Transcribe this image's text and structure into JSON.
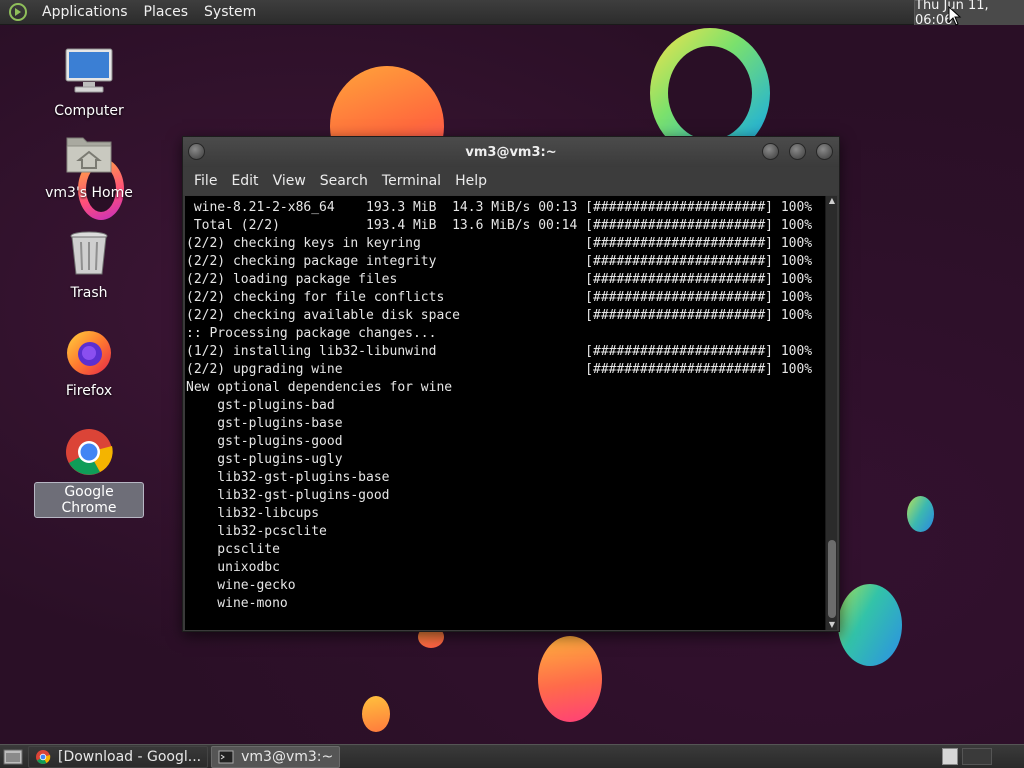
{
  "top_panel": {
    "menus": [
      "Applications",
      "Places",
      "System"
    ],
    "clock": "Thu Jun 11, 06:06"
  },
  "desktop_icons": [
    {
      "label": "Computer",
      "icon": "computer-icon"
    },
    {
      "label": "vm3's Home",
      "icon": "home-folder-icon"
    },
    {
      "label": "Trash",
      "icon": "trash-icon"
    },
    {
      "label": "Firefox",
      "icon": "firefox-icon"
    },
    {
      "label": "Google Chrome",
      "icon": "chrome-icon",
      "selected": true
    }
  ],
  "terminal": {
    "title": "vm3@vm3:~",
    "menu": [
      "File",
      "Edit",
      "View",
      "Search",
      "Terminal",
      "Help"
    ],
    "lines": [
      " wine-8.21-2-x86_64    193.3 MiB  14.3 MiB/s 00:13 [######################] 100%",
      " Total (2/2)           193.4 MiB  13.6 MiB/s 00:14 [######################] 100%",
      "(2/2) checking keys in keyring                     [######################] 100%",
      "(2/2) checking package integrity                   [######################] 100%",
      "(2/2) loading package files                        [######################] 100%",
      "(2/2) checking for file conflicts                  [######################] 100%",
      "(2/2) checking available disk space                [######################] 100%",
      ":: Processing package changes...",
      "(1/2) installing lib32-libunwind                   [######################] 100%",
      "(2/2) upgrading wine                               [######################] 100%",
      "New optional dependencies for wine",
      "    gst-plugins-bad",
      "    gst-plugins-base",
      "    gst-plugins-good",
      "    gst-plugins-ugly",
      "    lib32-gst-plugins-base",
      "    lib32-gst-plugins-good",
      "    lib32-libcups",
      "    lib32-pcsclite",
      "    pcsclite",
      "    unixodbc",
      "    wine-gecko",
      "    wine-mono"
    ]
  },
  "taskbar": {
    "tasks": [
      {
        "label": "[Download - Googl...",
        "icon": "chrome-icon",
        "active": false
      },
      {
        "label": "vm3@vm3:~",
        "icon": "terminal-icon",
        "active": true
      }
    ]
  }
}
